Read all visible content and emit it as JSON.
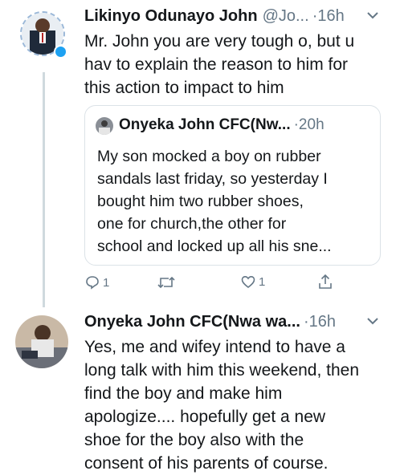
{
  "tweet1": {
    "name": "Likinyo Odunayo John",
    "handle": "@Jo...",
    "time": "·16h",
    "lines": [
      "Mr. John you are very tough o, but u",
      "hav to explain the reason to him for",
      "this action to impact to him"
    ]
  },
  "quote": {
    "name": "Onyeka John CFC(Nw...",
    "time": "·20h",
    "lines": [
      "My son mocked a boy on rubber",
      "sandals last friday, so yesterday I",
      "bought him two rubber shoes,",
      "one for church,the other for",
      "school and locked up all his sne..."
    ]
  },
  "actions": {
    "reply_count": "1",
    "like_count": "1",
    "reply_icon": "reply-icon",
    "retweet_icon": "retweet-icon",
    "like_icon": "heart-icon",
    "share_icon": "share-icon"
  },
  "tweet2": {
    "name": "Onyeka John CFC(Nwa wa...",
    "time": "·16h",
    "lines": [
      "Yes, me and wifey intend to have a",
      "long talk with him this weekend, then",
      "find the boy and make him",
      "apologize.... hopefully get a new",
      "shoe for the boy also with the",
      "consent of his parents of course."
    ]
  },
  "colors": {
    "text": "#14171a",
    "muted": "#657786",
    "border": "#dbe2e7",
    "thread_line": "#cfd9de",
    "verified_badge": "#1da1f2"
  }
}
